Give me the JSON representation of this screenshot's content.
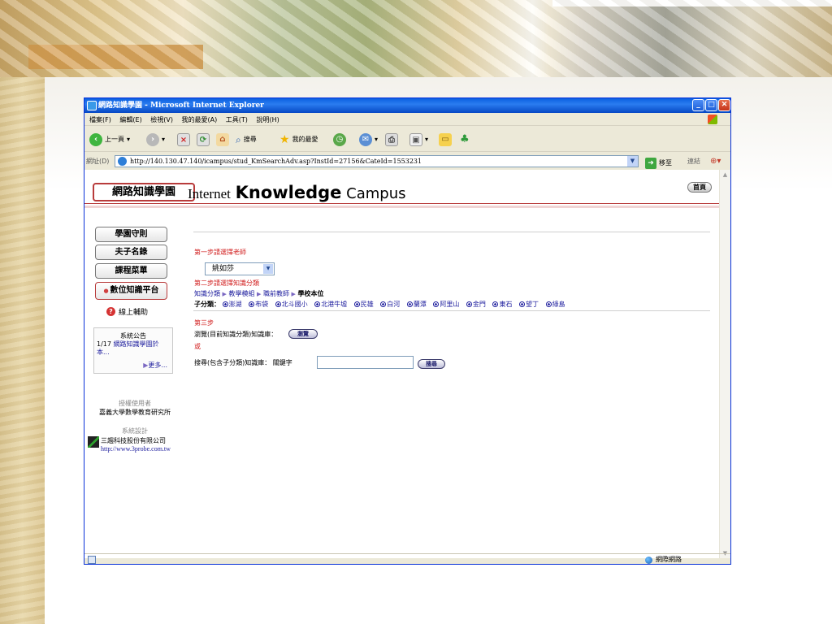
{
  "window": {
    "title": "網路知識學園 - Microsoft Internet Explorer",
    "menu": [
      "檔案(F)",
      "編輯(E)",
      "檢視(V)",
      "我的最愛(A)",
      "工具(T)",
      "說明(H)"
    ],
    "toolbar": {
      "back": "上一頁",
      "search": "搜尋",
      "favorites": "我的最愛"
    },
    "address_label": "網址(D)",
    "url": "http://140.130.47.140/icampus/stud_KmSearchAdv.asp?InstId=27156&CateId=1553231",
    "go": "移至",
    "links": "連結",
    "status_zone": "網際網路"
  },
  "site": {
    "logo": "網路知識學園",
    "title_word1": "Internet",
    "title_word2": "Knowledge",
    "title_word3": "Campus",
    "home_button": "首頁"
  },
  "sidebar": {
    "buttons": [
      "學園守則",
      "夫子名錄",
      "課程菜單",
      "數位知識平台"
    ],
    "help": "線上輔助",
    "notice_title": "系統公告",
    "notice_date": "1/17",
    "notice_item": "網路知識學園於本...",
    "notice_more": "更多...",
    "auth_label": "授權使用者",
    "auth_name": "嘉義大學數學教育研究所",
    "design_label": "系統設計",
    "company_name": "三趨科技股份有限公司",
    "company_url": "http://www.3probe.com.tw"
  },
  "main": {
    "step1": "第一步請選擇老師",
    "teacher_selected": "姚如莎",
    "step2": "第二步請選擇知識分類",
    "breadcrumb": [
      "知識分類",
      "教學模組",
      "職前教師",
      "學校本位"
    ],
    "subcat_label": "子分類：",
    "subcats": [
      "澎湖",
      "布袋",
      "北斗國小",
      "北港牛墟",
      "民雄",
      "白河",
      "蘭潭",
      "阿里山",
      "金門",
      "東石",
      "望丁",
      "綠島"
    ],
    "step3": "第三步",
    "browse_label": "瀏覽(目前知識分類)知識庫：",
    "browse_button": "瀏覽",
    "or": "或",
    "search_label": "搜尋(包含子分類)知識庫：  關鍵字",
    "search_button": "搜尋"
  }
}
